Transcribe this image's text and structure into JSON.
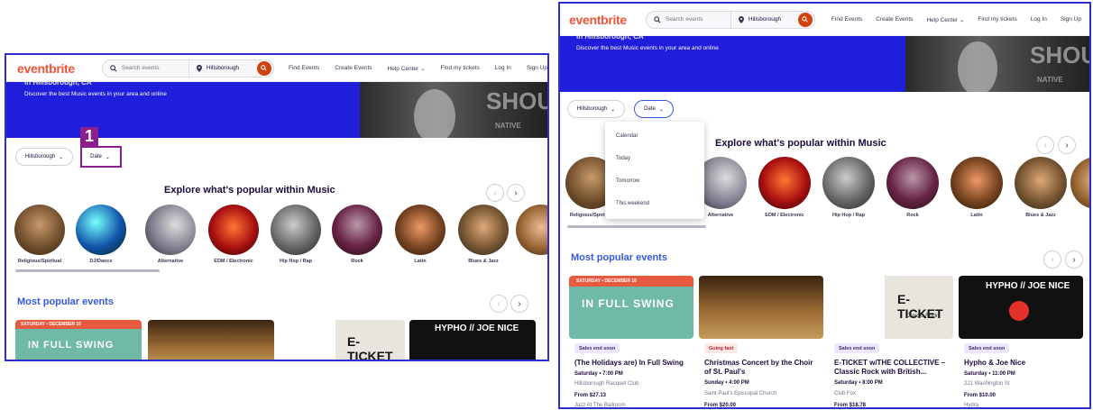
{
  "header": {
    "logo": "eventbrite",
    "search_placeholder": "Search events",
    "location": "Hillsborough",
    "nav": [
      "Find Events",
      "Create Events",
      "Help Center",
      "Find my tickets",
      "Log In",
      "Sign Up"
    ]
  },
  "hero": {
    "partial_title": "in Hillsborough, CA",
    "subtitle": "Discover the best Music events in your area and online",
    "photo_text_1": "SHOU",
    "photo_text_2": "NATIVE"
  },
  "filters": {
    "location": "Hillsborough",
    "date": "Date"
  },
  "date_menu": [
    "Calendar",
    "Today",
    "Tomorrow",
    "This weekend"
  ],
  "marker": {
    "label": "1"
  },
  "explore_title": "Explore what's popular within Music",
  "categories": [
    {
      "label": "Religious/Spiritual"
    },
    {
      "label": "DJ/Dance"
    },
    {
      "label": "Alternative"
    },
    {
      "label": "EDM / Electronic"
    },
    {
      "label": "Hip Hop / Rap"
    },
    {
      "label": "Rock"
    },
    {
      "label": "Latin"
    },
    {
      "label": "Blues & Jazz"
    }
  ],
  "popular_title": "Most popular events",
  "events": [
    {
      "badge": "Sales end soon",
      "title_l1": "(The Holidays are) In Full Swing",
      "title_l2": "",
      "date": "Saturday • 7:00 PM",
      "venue": "Hillsborough Racquet Club",
      "price": "From $27.13",
      "organizer": "Jazz At The Ballroom",
      "img_text_1": "SATURDAY • DECEMBER 16",
      "img_text_2": "IN FULL SWING"
    },
    {
      "badge": "Going fast",
      "title_l1": "Christmas Concert by the Choir",
      "title_l2": "of St. Paul's",
      "date": "Sunday • 4:00 PM",
      "venue": "Saint Paul's Episcopal Church",
      "price": "From $20.00",
      "organizer": ""
    },
    {
      "badge": "Sales end soon",
      "title_l1": "E-TICKET w/THE COLLECTIVE –",
      "title_l2": "Classic Rock with British...",
      "date": "Saturday • 8:00 PM",
      "venue": "Club Fox",
      "price": "From $18.78",
      "organizer": "",
      "img_text_1": "E-TICKET",
      "img_text_2": "Classic Rock"
    },
    {
      "badge": "Sales end soon",
      "title_l1": "Hypho & Joe Nice",
      "title_l2": "",
      "date": "Saturday • 11:00 PM",
      "venue": "221 Washington St",
      "price": "From $10.00",
      "organizer": "Hydra",
      "img_text_1": "HYPHO // JOE NICE"
    }
  ],
  "colors": {
    "brand": "#f05537",
    "hero": "#1e1edb",
    "link": "#3659e3",
    "annotation": "#8c1f8c"
  }
}
